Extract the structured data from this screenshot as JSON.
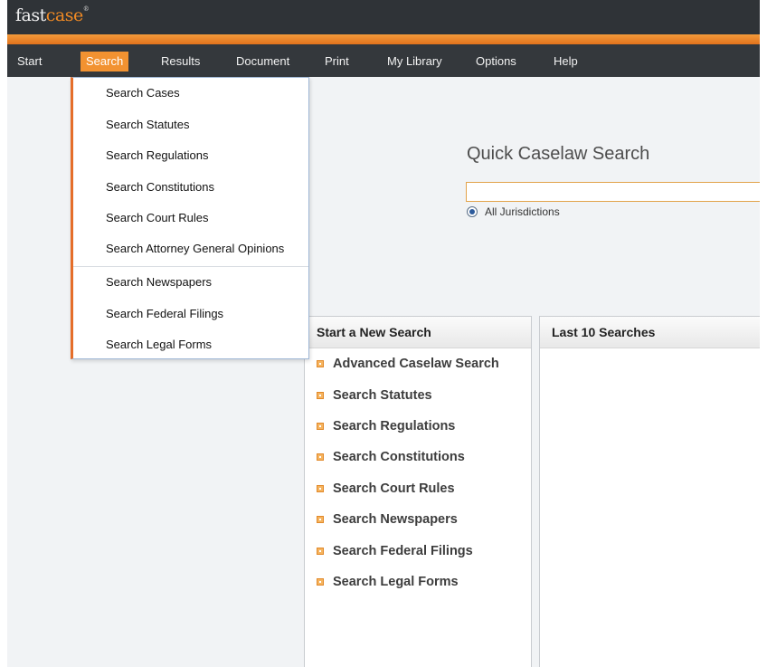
{
  "app": {
    "logo_prefix": "fast",
    "logo_suffix": "case",
    "logo_mark": "®"
  },
  "menu": {
    "items": [
      {
        "label": "Start"
      },
      {
        "label": "Search"
      },
      {
        "label": "Results"
      },
      {
        "label": "Document"
      },
      {
        "label": "Print"
      },
      {
        "label": "My Library"
      },
      {
        "label": "Options"
      },
      {
        "label": "Help"
      }
    ],
    "active": "Search"
  },
  "search_menu": {
    "items": [
      "Search Cases",
      "Search Statutes",
      "Search Regulations",
      "Search Constitutions",
      "Search Court Rules",
      "Search Attorney General Opinions",
      "Search Newspapers",
      "Search Federal Filings",
      "Search Legal Forms"
    ]
  },
  "quick_search": {
    "title": "Quick Caselaw Search",
    "value": "",
    "jurisdiction_label": "All Jurisdictions"
  },
  "new_search_panel": {
    "header": "Start a New Search",
    "links": [
      "Advanced Caselaw Search",
      "Search Statutes",
      "Search Regulations",
      "Search Constitutions",
      "Search Court Rules",
      "Search Newspapers",
      "Search Federal Filings",
      "Search Legal Forms"
    ]
  },
  "last_searches_panel": {
    "header": "Last 10 Searches"
  },
  "colors": {
    "accent": "#f29231",
    "titlebar": "#2f3337",
    "menubar": "#34383c"
  }
}
